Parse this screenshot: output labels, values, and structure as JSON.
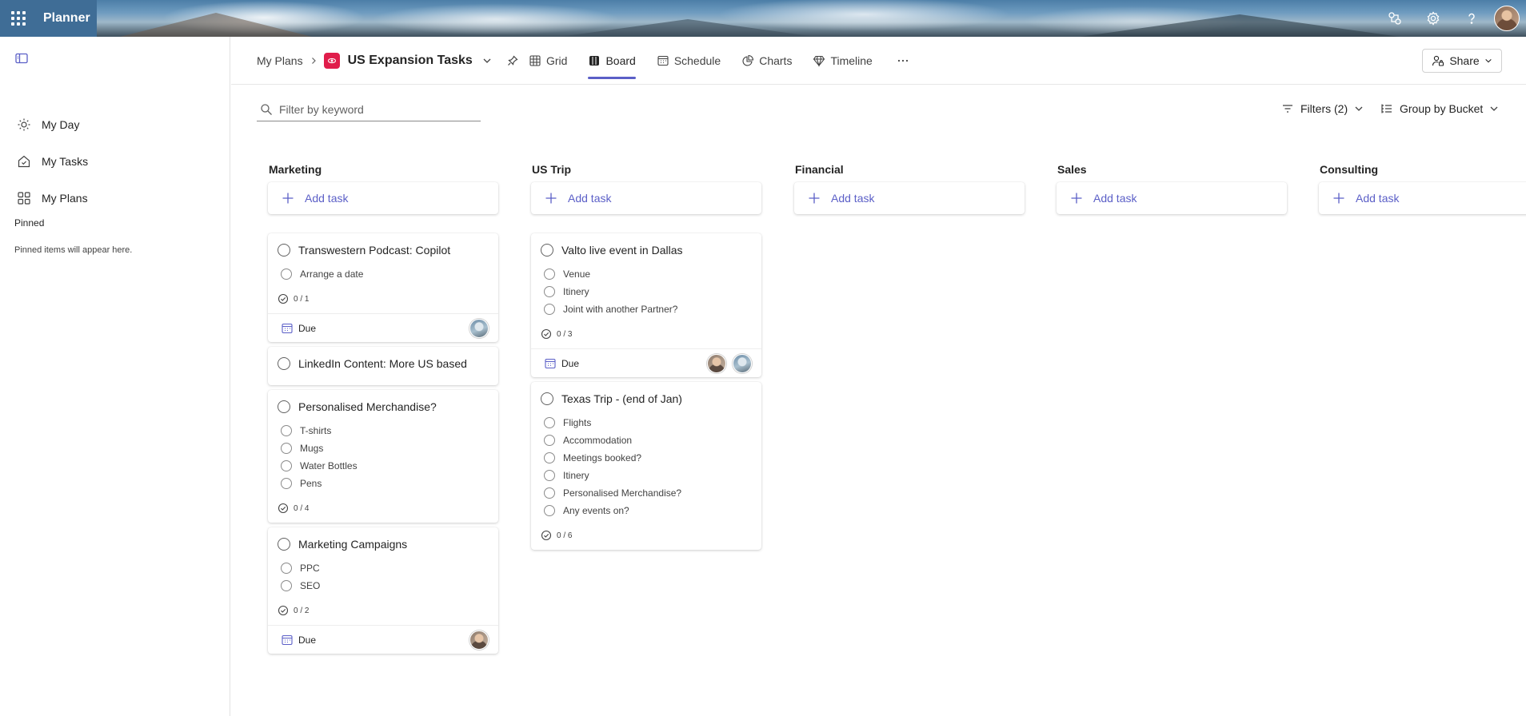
{
  "app": {
    "name": "Planner"
  },
  "header": {
    "breadcrumb_root": "My Plans",
    "plan_title": "US Expansion Tasks",
    "views": [
      {
        "label": "Grid",
        "active": false
      },
      {
        "label": "Board",
        "active": true
      },
      {
        "label": "Schedule",
        "active": false
      },
      {
        "label": "Charts",
        "active": false
      },
      {
        "label": "Timeline",
        "active": false
      }
    ],
    "share_label": "Share"
  },
  "sidebar": {
    "items": [
      {
        "label": "My Day",
        "icon": "sun-icon"
      },
      {
        "label": "My Tasks",
        "icon": "home-check-icon"
      },
      {
        "label": "My Plans",
        "icon": "grid-apps-icon"
      }
    ],
    "pinned_heading": "Pinned",
    "pinned_empty": "Pinned items will appear here."
  },
  "toolbar": {
    "filter_placeholder": "Filter by keyword",
    "filters_label": "Filters (2)",
    "group_label": "Group by Bucket"
  },
  "colors": {
    "accent": "#5b5fc7",
    "plan_icon": "#e01d4b",
    "app_tile": "#3f6d96"
  },
  "board": {
    "add_task_label": "Add task",
    "buckets": [
      {
        "name": "Marketing",
        "cards": [
          {
            "title": "Transwestern Podcast: Copilot",
            "checklist": [
              "Arrange a date"
            ],
            "progress": "0 / 1",
            "due": "Due",
            "assignees": [
              "a"
            ]
          },
          {
            "title": "LinkedIn Content: More US based",
            "checklist": [],
            "progress": "",
            "due": "",
            "assignees": []
          },
          {
            "title": "Personalised Merchandise?",
            "checklist": [
              "T-shirts",
              "Mugs",
              "Water Bottles",
              "Pens"
            ],
            "progress": "0 / 4",
            "due": "",
            "assignees": []
          },
          {
            "title": "Marketing Campaigns",
            "checklist": [
              "PPC",
              "SEO"
            ],
            "progress": "0 / 2",
            "due": "Due",
            "assignees": [
              "b"
            ]
          }
        ]
      },
      {
        "name": "US Trip",
        "cards": [
          {
            "title": "Valto live event in Dallas",
            "checklist": [
              "Venue",
              "Itinery",
              "Joint with another Partner?"
            ],
            "progress": "0 / 3",
            "due": "Due",
            "assignees": [
              "b",
              "a"
            ]
          },
          {
            "title": "Texas Trip - (end of Jan)",
            "checklist": [
              "Flights",
              "Accommodation",
              "Meetings booked?",
              "Itinery",
              "Personalised Merchandise?",
              "Any events on?"
            ],
            "progress": "0 / 6",
            "due": "",
            "assignees": []
          }
        ]
      },
      {
        "name": "Financial",
        "cards": []
      },
      {
        "name": "Sales",
        "cards": []
      },
      {
        "name": "Consulting",
        "cards": []
      }
    ]
  }
}
